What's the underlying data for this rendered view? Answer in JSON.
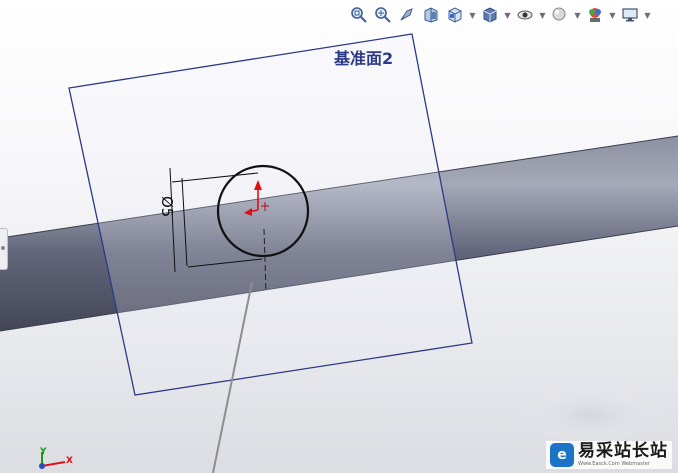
{
  "view": {
    "plane_label": "基准面2",
    "dimension_text": "Ø5"
  },
  "toolbar": {
    "buttons": [
      {
        "icon": "zoom-to-fit-icon"
      },
      {
        "icon": "zoom-to-area-icon"
      },
      {
        "icon": "previous-view-icon"
      },
      {
        "icon": "section-view-icon"
      },
      {
        "icon": "view-orientation-icon"
      },
      {
        "icon": "display-style-icon"
      },
      {
        "icon": "hide-show-items-icon"
      },
      {
        "icon": "edit-appearance-icon"
      },
      {
        "icon": "apply-scene-icon"
      },
      {
        "icon": "view-settings-icon"
      }
    ]
  },
  "triad": {
    "x_label": "X",
    "y_label": "Y"
  },
  "watermark": {
    "logo_letter": "e",
    "title": "易采站长站",
    "subtitle": "Www.Easck.Com Webmaster"
  },
  "colors": {
    "plane_edge": "#2b3a87",
    "rod_dark": "#4e5264",
    "rod_light": "#9a9eae",
    "origin_arrow": "#e01010"
  }
}
